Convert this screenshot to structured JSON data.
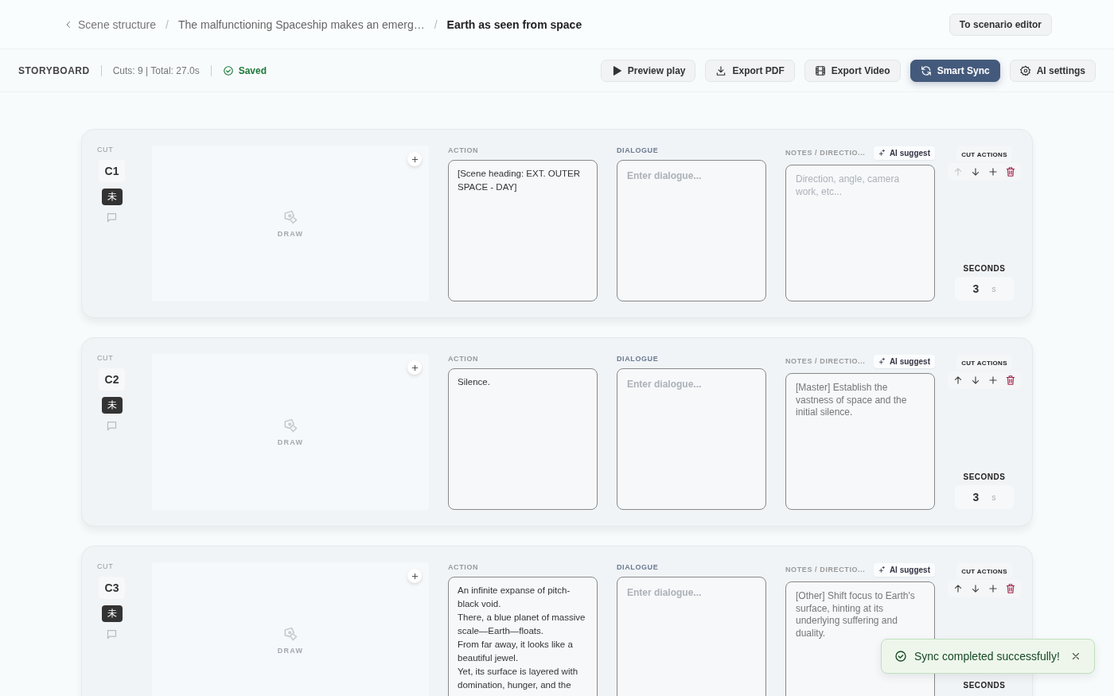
{
  "breadcrumb": {
    "back": "Scene structure",
    "items": [
      {
        "separator": "/",
        "label": "The malfunctioning Spaceship makes an emerg…",
        "current": false
      },
      {
        "separator": "/",
        "label": "Earth as seen from space",
        "current": true
      }
    ]
  },
  "header_button": "To scenario editor",
  "toolbar": {
    "title": "STORYBOARD",
    "stats": "Cuts: 9 | Total: 27.0s",
    "status": "Saved",
    "buttons": [
      {
        "label": "Preview play",
        "primary": false
      },
      {
        "label": "Export PDF",
        "primary": false
      },
      {
        "label": "Export Video",
        "primary": false
      },
      {
        "label": "Smart Sync",
        "primary": true
      },
      {
        "label": "AI settings",
        "primary": false
      }
    ]
  },
  "cuts": [
    {
      "cut_label": "CUT",
      "id": "C1",
      "badge": "未",
      "draw_label": "DRAW",
      "action_label": "ACTION",
      "action": "[Scene heading: EXT. OUTER SPACE - DAY]",
      "dialogue_label": "DIALOGUE",
      "dialogue_placeholder": "Enter dialogue...",
      "notes_label": "NOTES / DIRECTIO...",
      "ai_suggest": "AI suggest",
      "notes_placeholder": "Direction, angle, camera work, etc...",
      "actions_label": "CUT ACTIONS",
      "move_up_disabled": true,
      "seconds_label": "SECONDS",
      "seconds": "3",
      "unit": "s"
    },
    {
      "cut_label": "CUT",
      "id": "C2",
      "badge": "未",
      "draw_label": "DRAW",
      "action_label": "ACTION",
      "action": "Silence.",
      "dialogue_label": "DIALOGUE",
      "dialogue_placeholder": "Enter dialogue...",
      "notes_label": "NOTES / DIRECTIO...",
      "ai_suggest": "AI suggest",
      "notes": "[Master] Establish the vastness of space and the initial silence.",
      "actions_label": "CUT ACTIONS",
      "move_up_disabled": false,
      "seconds_label": "SECONDS",
      "seconds": "3",
      "unit": "s"
    },
    {
      "cut_label": "CUT",
      "id": "C3",
      "badge": "未",
      "draw_label": "DRAW",
      "action_label": "ACTION",
      "action": "An infinite expanse of pitch-black void.\nThere, a blue planet of massive scale—Earth—floats.\nFrom far away, it looks like a beautiful jewel.\nYet, its surface is layered with domination, hunger, and the",
      "dialogue_label": "DIALOGUE",
      "dialogue_placeholder": "Enter dialogue...",
      "notes_label": "NOTES / DIRECTIO...",
      "ai_suggest": "AI suggest",
      "notes": "[Other] Shift focus to Earth's surface, hinting at its underlying suffering and duality.",
      "actions_label": "CUT ACTIONS",
      "move_up_disabled": false,
      "seconds_label": "SECONDS"
    }
  ],
  "toast": {
    "message": "Sync completed successfully!"
  }
}
